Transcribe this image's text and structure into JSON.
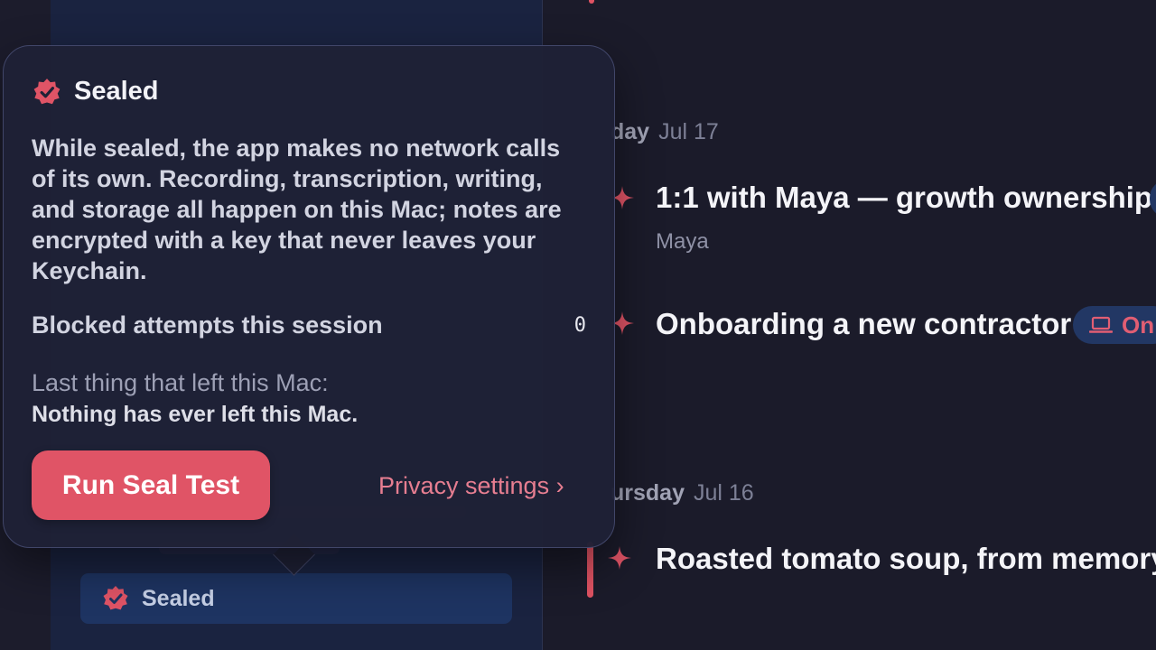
{
  "popover": {
    "title": "Sealed",
    "description": "While sealed, the app makes no network calls of its own. Recording, transcription, writing, and storage all happen on this Mac; notes are encrypted with a key that never leaves your Keychain.",
    "blocked_label": "Blocked attempts this session",
    "blocked_count": "0",
    "last_label": "Last thing that left this Mac:",
    "last_value": "Nothing has ever left this Mac.",
    "run_button": "Run Seal Test",
    "privacy_link": "Privacy settings ›"
  },
  "sidebar": {
    "seal_status": "Sealed"
  },
  "timeline": {
    "days": [
      {
        "day_visible": "day",
        "date": "Jul 17"
      },
      {
        "day_visible": "ursday",
        "date": "Jul 16"
      }
    ],
    "events": [
      {
        "title": "1:1 with Maya — growth ownership",
        "subtitle": "Maya"
      },
      {
        "title": "Onboarding a new contractor",
        "tag": "On"
      },
      {
        "title": "Roasted tomato soup, from memory"
      }
    ]
  },
  "colors": {
    "accent": "#e05466",
    "sidebar_bg": "#1a2340",
    "main_bg": "#1b1b2a",
    "pill_bg": "#1e3462",
    "link": "#e77e91"
  },
  "icons": [
    "sealed-badge-icon",
    "sparkle-icon",
    "laptop-icon"
  ]
}
